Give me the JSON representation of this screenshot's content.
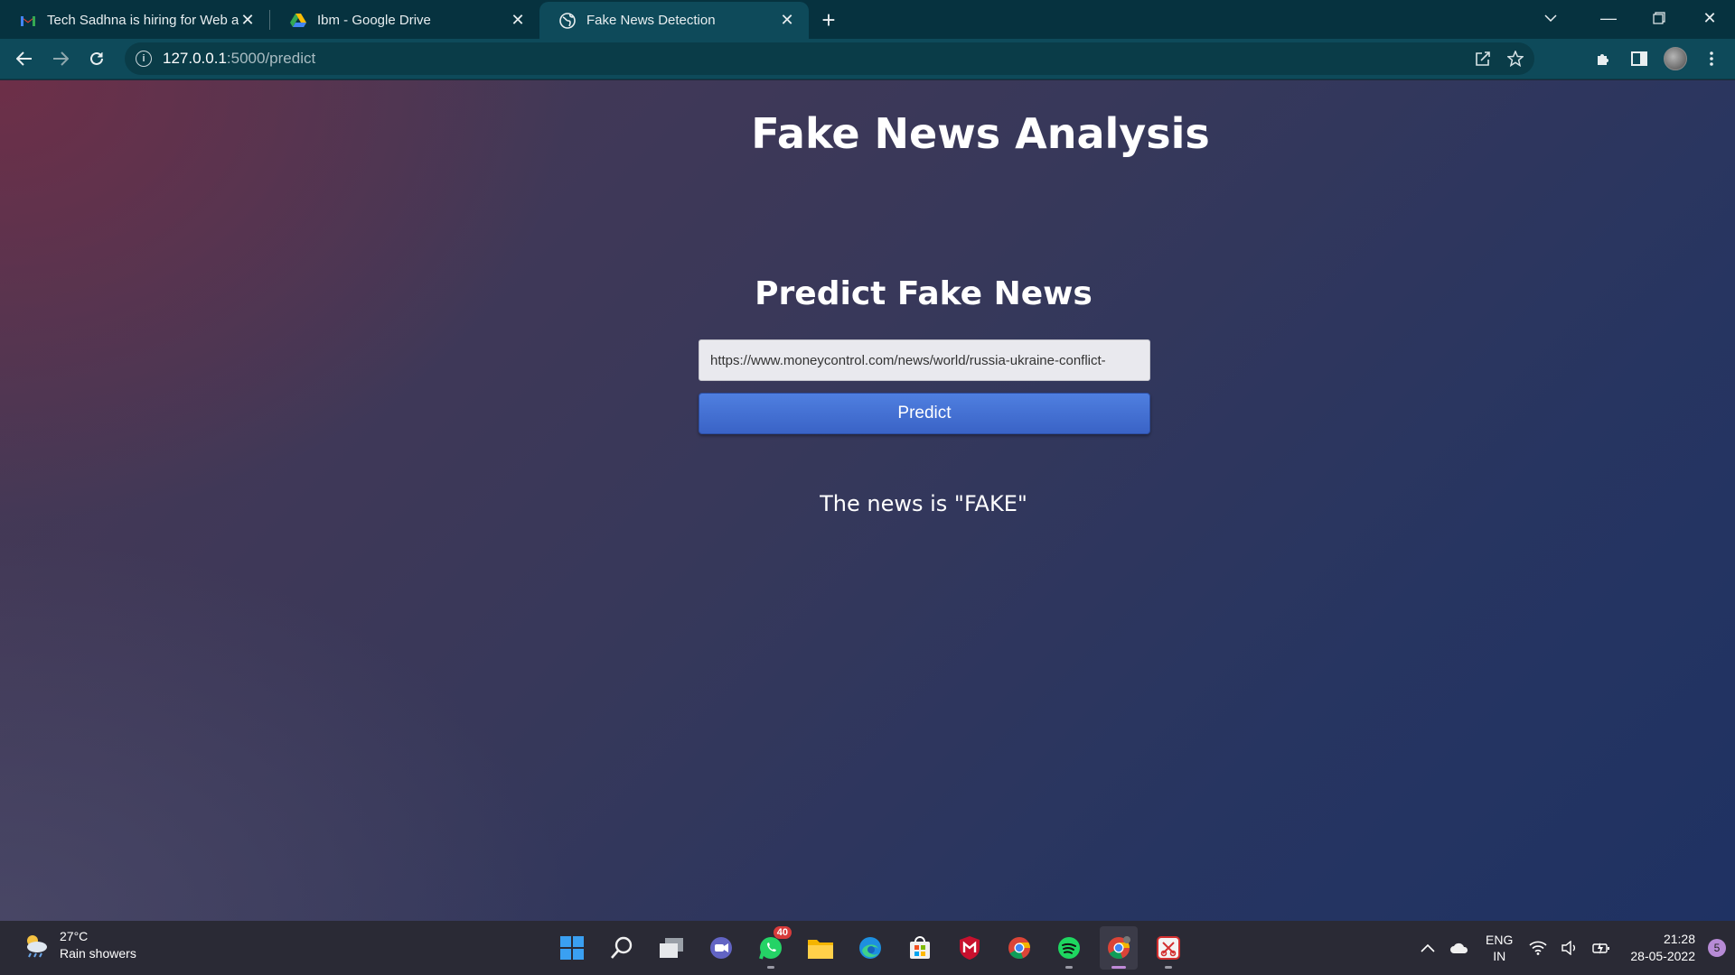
{
  "browser": {
    "tabs": [
      {
        "title": "Tech Sadhna is hiring for Web and",
        "icon": "gmail-icon",
        "active": false
      },
      {
        "title": "Ibm - Google Drive",
        "icon": "google-drive-icon",
        "active": false
      },
      {
        "title": "Fake News Detection",
        "icon": "globe-icon",
        "active": true
      }
    ],
    "url_host": "127.0.0.1",
    "url_path": ":5000/predict"
  },
  "page": {
    "title": "Fake News Analysis",
    "form_heading": "Predict Fake News",
    "input_value": "https://www.moneycontrol.com/news/world/russia-ukraine-conflict-",
    "button_label": "Predict",
    "result_text": "The news is \"FAKE\""
  },
  "taskbar": {
    "weather_temp": "27°C",
    "weather_desc": "Rain showers",
    "whatsapp_badge": "40",
    "lang_top": "ENG",
    "lang_bottom": "IN",
    "time": "21:28",
    "date": "28-05-2022",
    "notification_count": "5"
  }
}
